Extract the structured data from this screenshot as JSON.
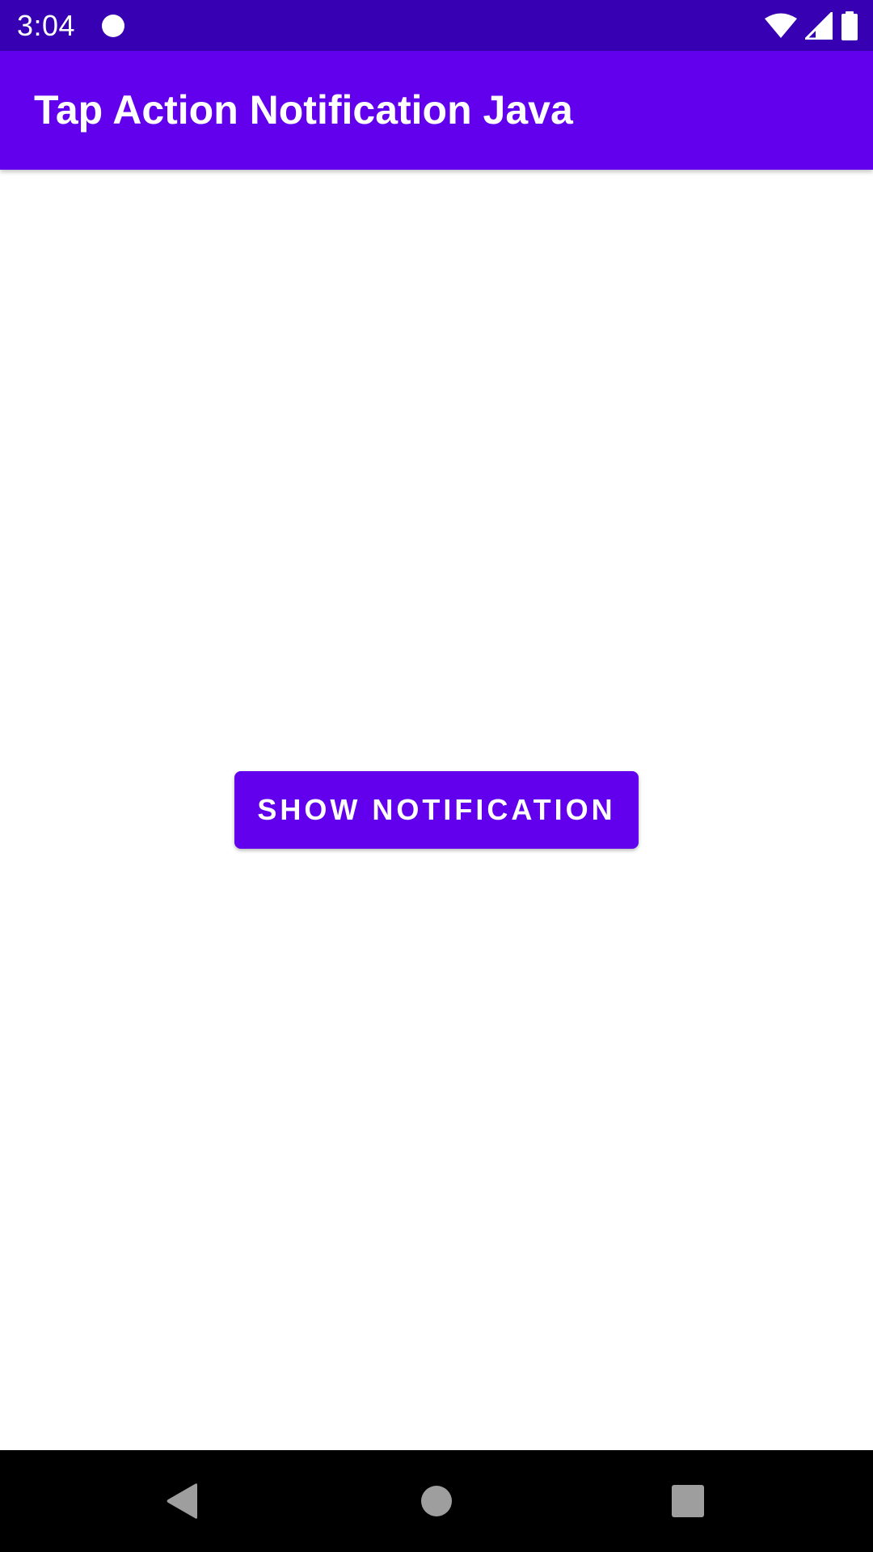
{
  "status_bar": {
    "time": "3:04",
    "icons": [
      "notification-dot-icon",
      "wifi-icon",
      "cellular-signal-icon",
      "battery-icon"
    ]
  },
  "app_bar": {
    "title": "Tap Action Notification Java"
  },
  "main": {
    "button_label": "Show Notification"
  },
  "nav_bar": {
    "icons": [
      "back-icon",
      "home-icon",
      "recents-icon"
    ]
  },
  "colors": {
    "status_bar": "#3700b3",
    "primary": "#6200ee",
    "background": "#ffffff",
    "nav_bar": "#000000",
    "nav_icons": "#9e9e9e"
  }
}
